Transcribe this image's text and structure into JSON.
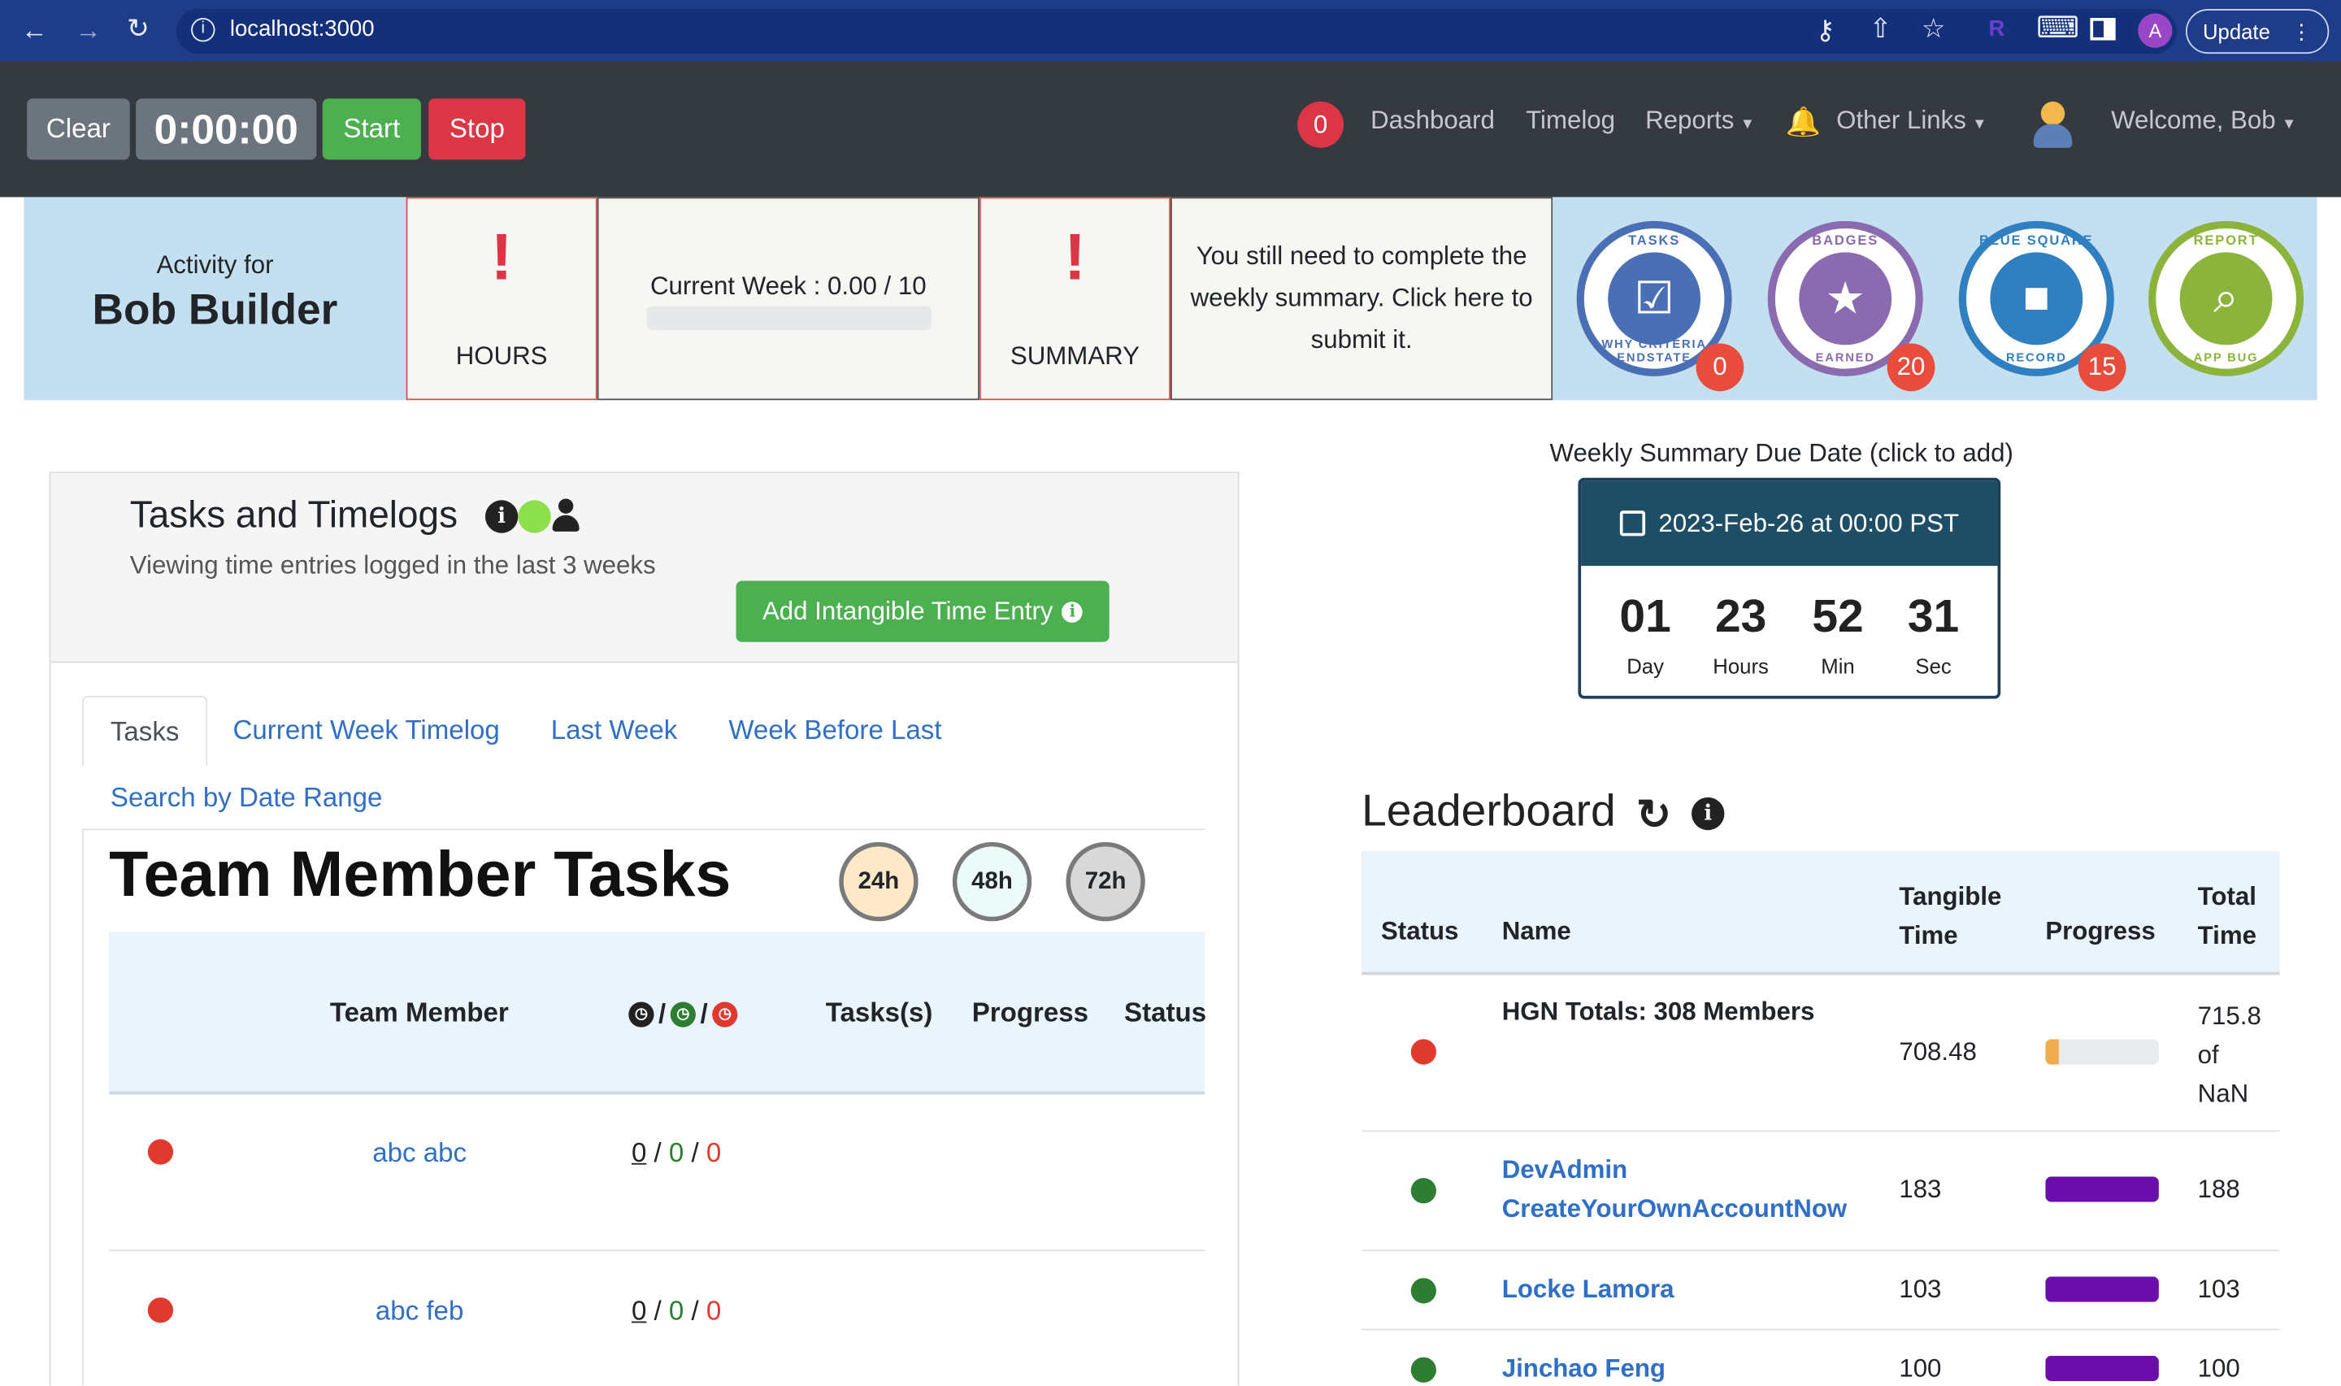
{
  "browser": {
    "url": "localhost:3000",
    "update_label": "Update",
    "profile_initial": "A"
  },
  "navbar": {
    "clear_label": "Clear",
    "timer": "0:00:00",
    "start_label": "Start",
    "stop_label": "Stop",
    "notification_count": "0",
    "links": [
      "Dashboard",
      "Timelog",
      "Reports",
      "Other Links"
    ],
    "welcome": "Welcome, Bob"
  },
  "summary_band": {
    "activity_for": "Activity for",
    "user_name": "Bob Builder",
    "hours_label": "HOURS",
    "current_week": "Current Week : 0.00 / 10",
    "week_progress": 0.0,
    "summary_label": "SUMMARY",
    "summary_message": "You still need to complete the weekly summary. Click here to submit it.",
    "badges": [
      {
        "top_text": "TASKS",
        "side_text": "WHY CRITERIA ENDSTATE",
        "count": "0",
        "color": "#4a6fb5",
        "icon": "checkbox-icon"
      },
      {
        "top_text": "BADGES",
        "side_text": "EARNED",
        "count": "20",
        "color": "#8a6bb0",
        "icon": "star-medal-icon"
      },
      {
        "top_text": "BLUE SQUARE",
        "side_text": "RECORD",
        "count": "15",
        "color": "#2f7fc1",
        "icon": "squares-icon"
      },
      {
        "top_text": "REPORT",
        "side_text": "APP BUG",
        "count": "",
        "color": "#8cb43c",
        "icon": "bug-search-icon"
      }
    ]
  },
  "tasks_panel": {
    "title": "Tasks and Timelogs",
    "subtitle": "Viewing time entries logged in the last 3 weeks",
    "add_button": "Add Intangible Time Entry",
    "tabs": [
      "Tasks",
      "Current Week Timelog",
      "Last Week",
      "Week Before Last",
      "Search by Date Range"
    ],
    "active_tab": "Tasks",
    "team_title": "Team Member Tasks",
    "filters": [
      {
        "label": "24h",
        "bg": "#fde9c8"
      },
      {
        "label": "48h",
        "bg": "#ecfafa"
      },
      {
        "label": "72h",
        "bg": "#d8d8d8"
      }
    ],
    "columns": [
      "Team Member",
      "Tasks(s)",
      "Progress",
      "Status"
    ],
    "rows": [
      {
        "name": "abc abc",
        "a": "0",
        "b": "0",
        "c": "0",
        "status_color": "#e03a2f"
      },
      {
        "name": "abc feb",
        "a": "0",
        "b": "0",
        "c": "0",
        "status_color": "#e03a2f"
      }
    ]
  },
  "due_date": {
    "caption": "Weekly Summary Due Date (click to add)",
    "date": "2023-Feb-26 at 00:00 PST",
    "countdown": [
      {
        "value": "01",
        "label": "Day"
      },
      {
        "value": "23",
        "label": "Hours"
      },
      {
        "value": "52",
        "label": "Min"
      },
      {
        "value": "31",
        "label": "Sec"
      }
    ]
  },
  "leaderboard": {
    "title": "Leaderboard",
    "columns": {
      "status": "Status",
      "name": "Name",
      "tangible_1": "Tangible",
      "tangible_2": "Time",
      "progress": "Progress",
      "total_1": "Total",
      "total_2": "Time"
    },
    "totals": {
      "name": "HGN Totals: 308 Members",
      "tangible": "708.48",
      "total_1": "715.8",
      "total_2": "of",
      "total_3": "NaN",
      "progress": 0.12,
      "status_color": "#e03a2f",
      "bar_color": "#f0ad4e"
    },
    "rows": [
      {
        "name_1": "DevAdmin",
        "name_2": "CreateYourOwnAccountNow",
        "tangible": "183",
        "total": "188",
        "progress": 1.0,
        "status_color": "#2e7d32"
      },
      {
        "name_1": "Locke Lamora",
        "name_2": "",
        "tangible": "103",
        "total": "103",
        "progress": 1.0,
        "status_color": "#2e7d32"
      },
      {
        "name_1": "Jinchao Feng",
        "name_2": "",
        "tangible": "100",
        "total": "100",
        "progress": 1.0,
        "status_color": "#2e7d32"
      }
    ]
  }
}
